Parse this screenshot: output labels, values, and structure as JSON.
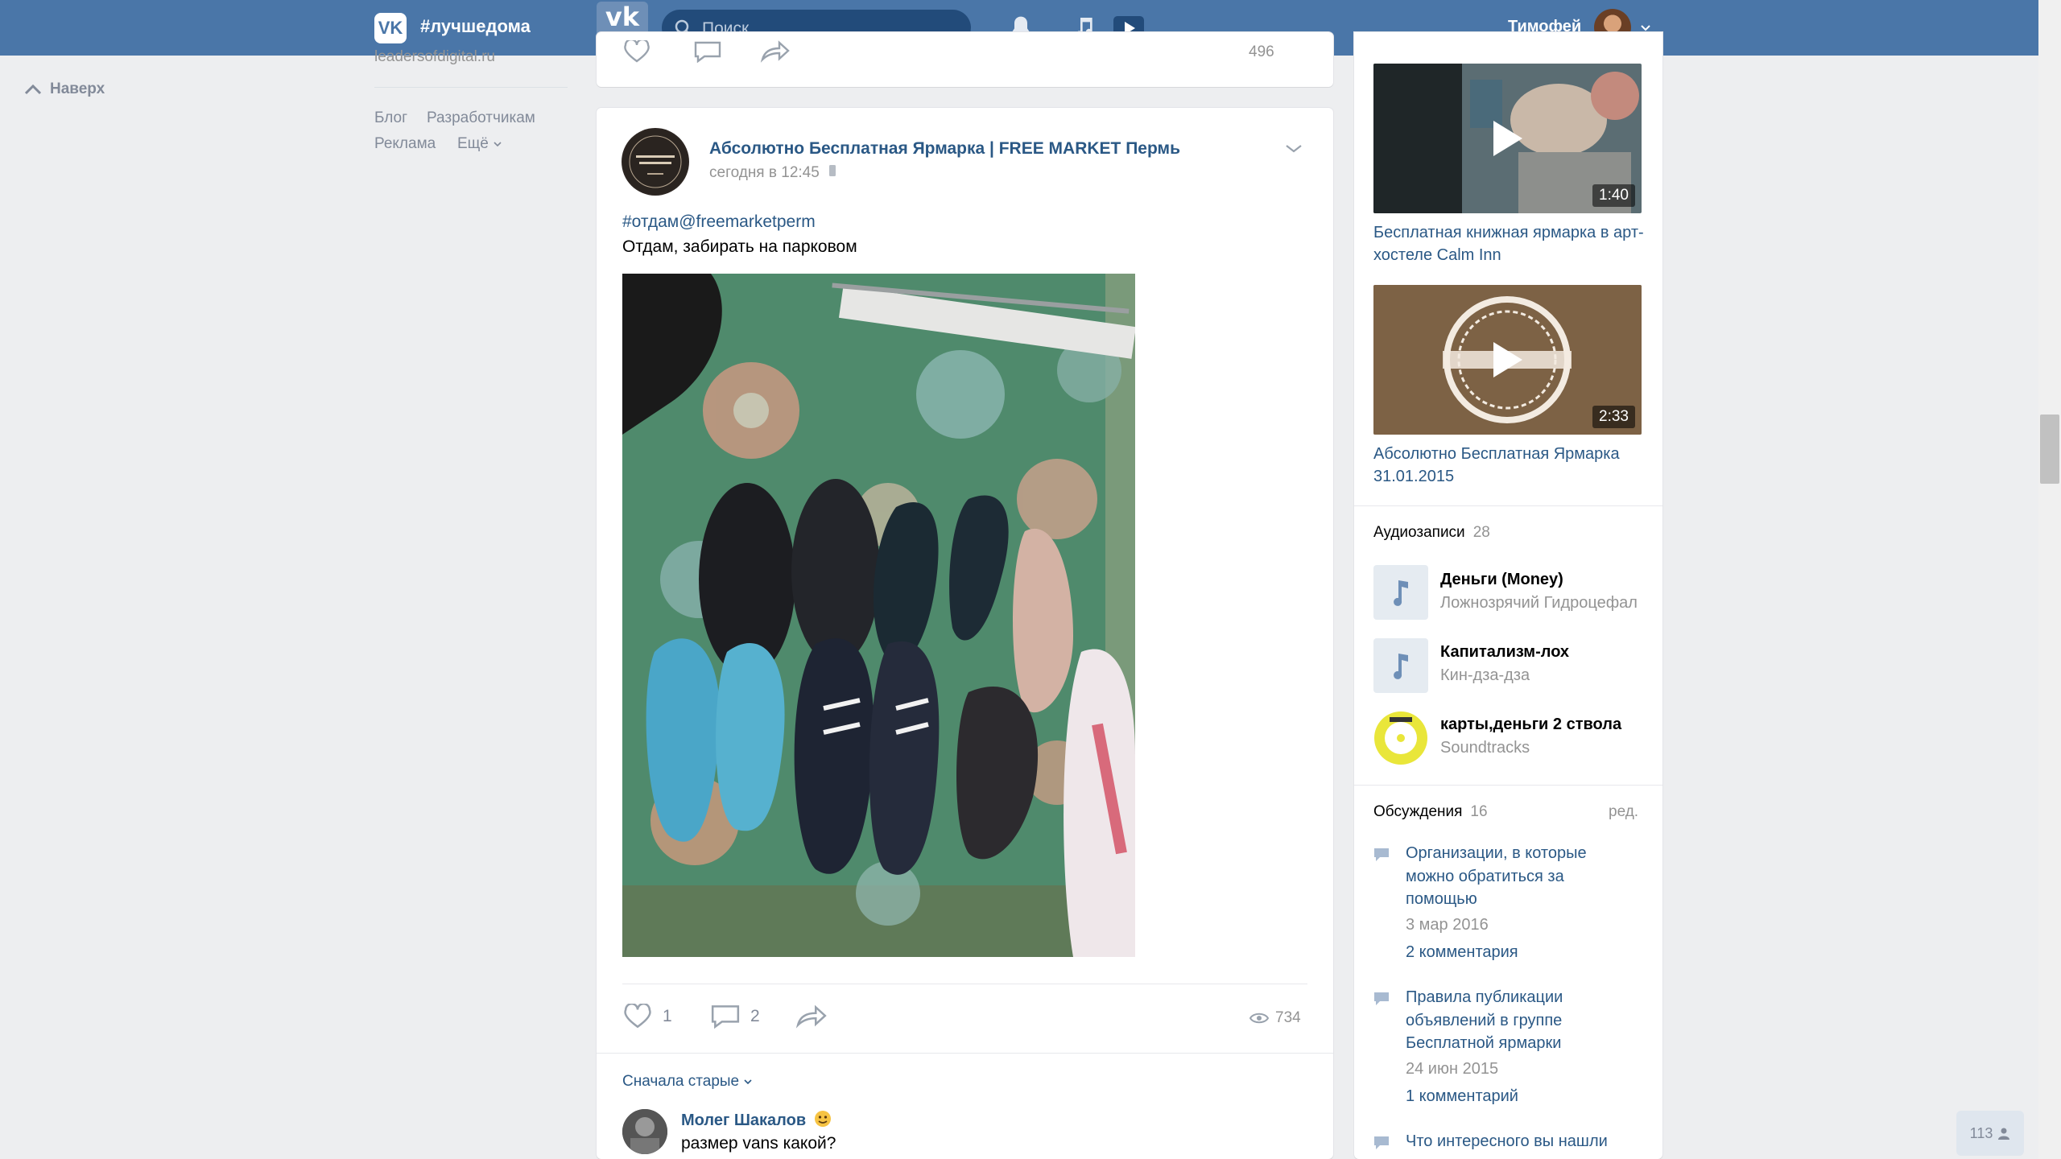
{
  "header": {
    "logo_text": "VK",
    "hashtag": "#лучшедома",
    "vkbutton_big": "vk",
    "vkbutton_small": "button",
    "search_placeholder": "Поиск",
    "user_name": "Тимофей",
    "bar_color": "#4a76a8"
  },
  "left": {
    "upward": "Наверх",
    "site": "leadersofdigital.ru",
    "links": [
      "Блог",
      "Разработчикам",
      "Реклама",
      "Ещё"
    ]
  },
  "post": {
    "author": "Абсолютно Бесплатная Ярмарка | FREE MARKET Пермь",
    "time": "сегодня в 12:45",
    "hashtag": "#отдам@freemarketperm",
    "text": "Отдам, забирать на парковом",
    "likes": "1",
    "comments": "2",
    "views": "734",
    "prev_views": "496",
    "sort_label": "Сначала старые",
    "comment": {
      "author": "Молег Шакалов",
      "text": "размер vans какой?"
    }
  },
  "videos": [
    {
      "title": "Бесплатная книжная ярмарка в арт-хостеле Calm Inn",
      "duration": "1:40"
    },
    {
      "title": "Абсолютно Бесплатная Ярмарка 31.01.2015",
      "duration": "2:33"
    }
  ],
  "audio": {
    "heading": "Аудиозаписи",
    "count": "28",
    "items": [
      {
        "title": "Деньги (Money)",
        "artist": "Ложнозрячий Гидроцефал"
      },
      {
        "title": "Капитализм-лох",
        "artist": "Кин-дза-дза"
      },
      {
        "title": "карты,деньги 2 ствола",
        "artist": "Soundtracks"
      }
    ]
  },
  "discussions": {
    "heading": "Обсуждения",
    "count": "16",
    "edit": "ред.",
    "items": [
      {
        "title": "Организации, в которые можно обратиться за помощью",
        "date": "3 мар 2016",
        "comments": "2 комментария"
      },
      {
        "title": "Правила публикации объявлений в группе Бесплатной ярмарки",
        "date": "24 июн 2015",
        "comments": "1 комментарий"
      },
      {
        "title": "Что интересного вы нашли"
      }
    ]
  },
  "online_count": "113"
}
